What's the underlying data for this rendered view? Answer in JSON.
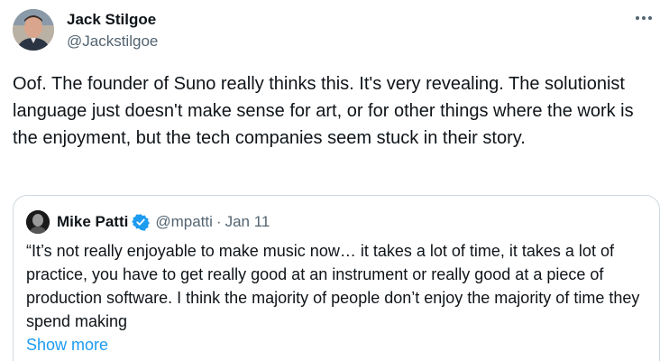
{
  "author": {
    "name": "Jack Stilgoe",
    "handle": "@Jackstilgoe"
  },
  "tweet": {
    "text": "Oof. The founder of Suno really thinks this. It's very revealing. The solutionist language just doesn't make sense for art, or for other things where the work is the enjoyment, but the tech companies seem stuck in their story."
  },
  "quote": {
    "name": "Mike Patti",
    "handle": "@mpatti",
    "separator": "·",
    "date": "Jan 11",
    "text": "“It’s not really enjoyable to make music now… it takes a lot of time, it takes a lot of practice, you have to get really good at an instrument or really good at a piece of production software. I think the majority of people don’t enjoy the majority of time they spend making",
    "show_more": "Show more"
  },
  "colors": {
    "accent": "#1d9bf0",
    "text_primary": "#0f1419",
    "text_secondary": "#536471",
    "border": "#cfd9de"
  },
  "icons": {
    "more": "more-horizontal-icon",
    "verified": "verified-badge-icon"
  }
}
